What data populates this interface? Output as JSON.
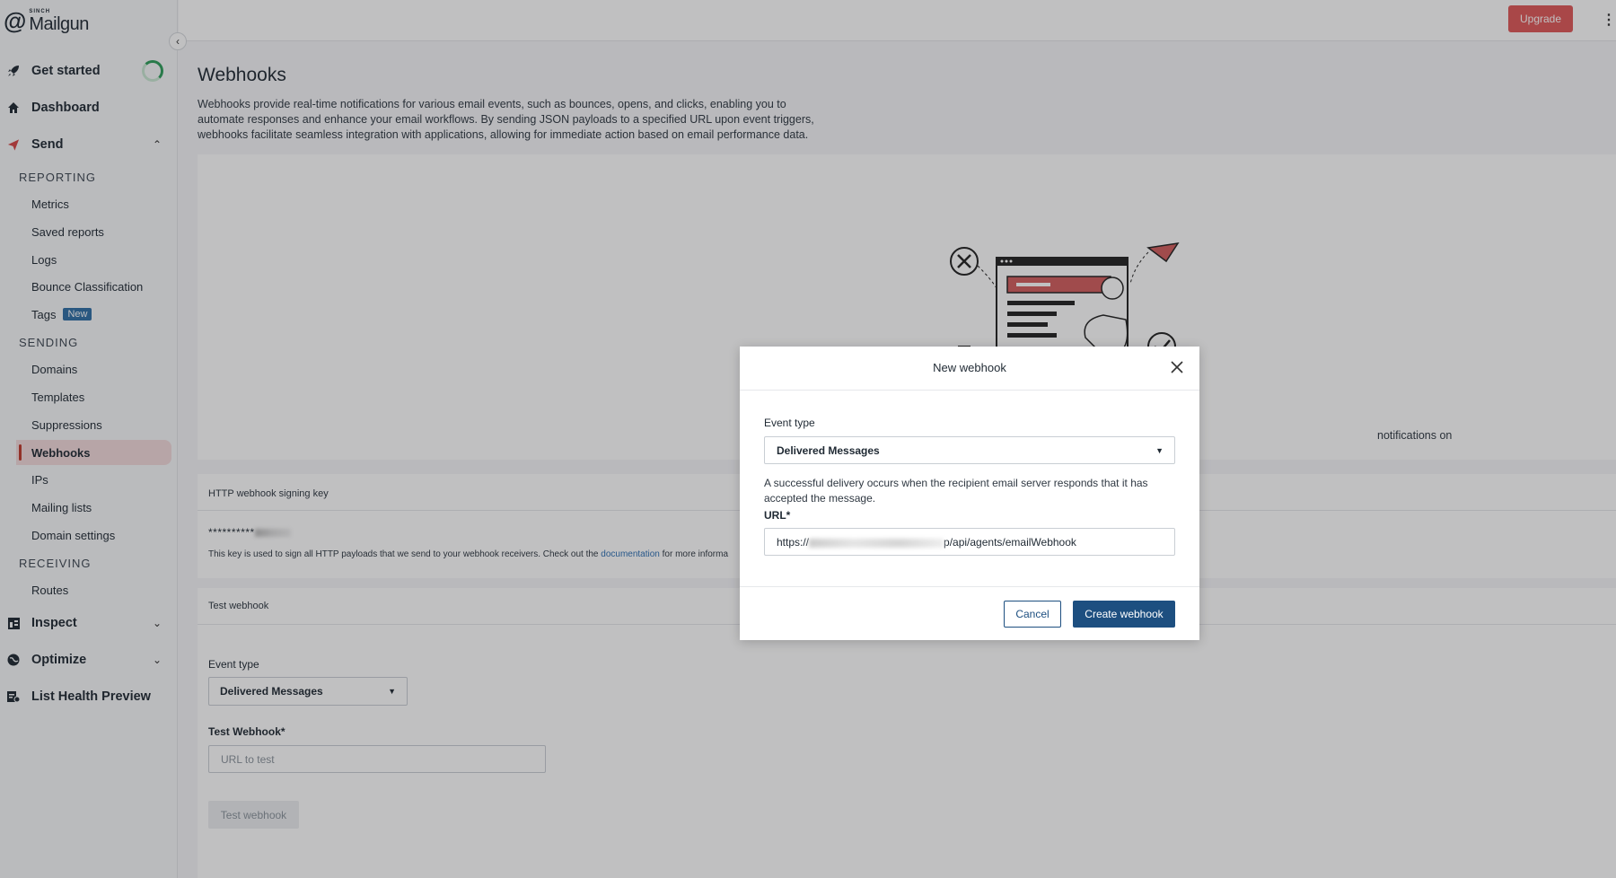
{
  "app": {
    "brand_small": "SINCH",
    "brand": "Mailgun"
  },
  "topbar": {
    "upgrade_label": "Upgrade"
  },
  "sidebar": {
    "get_started": "Get started",
    "dashboard": "Dashboard",
    "send": "Send",
    "reporting_header": "REPORTING",
    "reporting_items": [
      "Metrics",
      "Saved reports",
      "Logs",
      "Bounce Classification",
      "Tags"
    ],
    "tags_badge": "New",
    "sending_header": "SENDING",
    "sending_items": [
      "Domains",
      "Templates",
      "Suppressions",
      "Webhooks",
      "IPs",
      "Mailing lists",
      "Domain settings"
    ],
    "receiving_header": "RECEIVING",
    "receiving_items": [
      "Routes"
    ],
    "inspect": "Inspect",
    "optimize": "Optimize",
    "list_health": "List Health Preview",
    "active_item": "Webhooks"
  },
  "page": {
    "title": "Webhooks",
    "description": "Webhooks provide real-time notifications for various email events, such as bounces, opens, and clicks, enabling you to automate responses and enhance your email workflows. By sending JSON payloads to a specified URL upon event triggers, webhooks facilitate seamless integration with applications, allowing for immediate action based on email performance data.",
    "empty_text_partial": "notifications on"
  },
  "signing_key": {
    "header": "HTTP webhook signing key",
    "masked_value": "**********",
    "note_before": "This key is used to sign all HTTP payloads that we send to your webhook receivers. Check out the ",
    "note_link": "documentation",
    "note_after": " for more informa"
  },
  "test_webhook": {
    "header": "Test webhook",
    "event_type_label": "Event type",
    "event_type_value": "Delivered Messages",
    "url_label": "Test Webhook*",
    "url_placeholder": "URL to test",
    "button_label": "Test webhook"
  },
  "modal": {
    "title": "New webhook",
    "event_type_label": "Event type",
    "event_type_value": "Delivered Messages",
    "help_text": "A successful delivery occurs when the recipient email server responds that it has accepted the message.",
    "url_label": "URL*",
    "url_prefix": "https://",
    "url_suffix": "p/api/agents/emailWebhook",
    "cancel_label": "Cancel",
    "create_label": "Create webhook"
  },
  "colors": {
    "brand_red": "#e05858",
    "primary_blue": "#1d4f80",
    "active_bg": "#f3dadb",
    "link_blue": "#2d6fb3"
  }
}
